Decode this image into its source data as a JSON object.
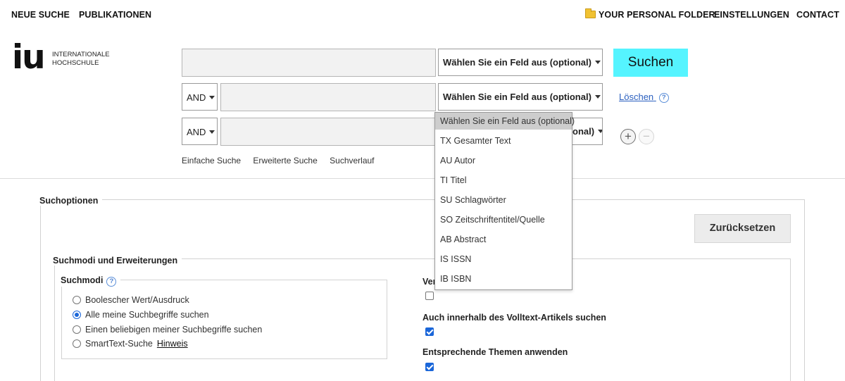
{
  "nav": {
    "new_search": "NEUE SUCHE",
    "publications": "PUBLIKATIONEN",
    "folder": "YOUR PERSONAL FOLDER",
    "settings": "EINSTELLUNGEN",
    "contact": "CONTACT"
  },
  "logo": {
    "mark": "iu",
    "line1": "INTERNATIONALE",
    "line2": "HOCHSCHULE"
  },
  "search": {
    "field_select_label": "Wählen Sie ein Feld aus (optional)",
    "field_select_label_partial": "onal)",
    "bool_op_1": "AND",
    "bool_op_2": "AND",
    "search_button": "Suchen",
    "clear_link": "Löschen",
    "help_glyph": "?",
    "add_row": "+",
    "remove_row": "−"
  },
  "search_modes": {
    "basic": "Einfache Suche",
    "advanced": "Erweiterte Suche",
    "history": "Suchverlauf"
  },
  "dropdown": {
    "items": [
      "Wählen Sie ein Feld aus (optional)",
      "TX Gesamter Text",
      "AU Autor",
      "TI Titel",
      "SU Schlagwörter",
      "SO Zeitschriftentitel/Quelle",
      "AB Abstract",
      "IS ISSN",
      "IB ISBN"
    ],
    "selected_index": 0
  },
  "options": {
    "title": "Suchoptionen",
    "reset_button": "Zurücksetzen",
    "section_title": "Suchmodi und Erweiterungen",
    "modes_title": "Suchmodi",
    "modes": [
      {
        "label": "Boolescher Wert/Ausdruck",
        "checked": false
      },
      {
        "label": "Alle meine Suchbegriffe suchen",
        "checked": true
      },
      {
        "label": "Einen beliebigen meiner Suchbegriffe suchen",
        "checked": false
      },
      {
        "label": "SmartText-Suche",
        "checked": false
      }
    ],
    "hint_link": "Hinweis",
    "right_label_1_partial": "Ver",
    "right_label_2": "Auch innerhalb des Volltext-Artikels suchen",
    "right_label_3": "Entsprechende Themen anwenden",
    "checkbox_1_checked": false,
    "checkbox_2_checked": true,
    "checkbox_3_checked": true
  },
  "colors": {
    "search_button_bg": "#55f4ff",
    "link_blue": "#2a5fbf",
    "radio_blue": "#1a66d9"
  }
}
